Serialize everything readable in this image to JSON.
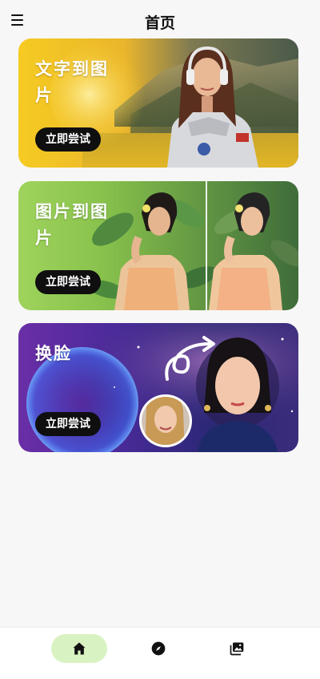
{
  "header": {
    "title": "首页",
    "menu_icon": "hamburger-menu-icon"
  },
  "cards": [
    {
      "id": "text-to-image",
      "title": "文字到图片",
      "button_label": "立即尝试",
      "gradient_colors": [
        "#f4c51d",
        "#e8b72a"
      ]
    },
    {
      "id": "image-to-image",
      "title": "图片到图片",
      "button_label": "立即尝试",
      "gradient_colors": [
        "#9bd05a",
        "#86c048"
      ]
    },
    {
      "id": "face-swap",
      "title": "换脸",
      "button_label": "立即尝试",
      "gradient_colors": [
        "#6a2fa8",
        "#3a1f8c"
      ]
    }
  ],
  "bottom_nav": {
    "items": [
      {
        "id": "home",
        "icon": "home-icon",
        "active": true
      },
      {
        "id": "explore",
        "icon": "compass-icon",
        "active": false
      },
      {
        "id": "gallery",
        "icon": "gallery-icon",
        "active": false
      }
    ],
    "active_pill_color": "#d9f2c2"
  },
  "colors": {
    "background": "#f7f7f7",
    "button_bg": "#0f0f10",
    "button_text": "#ffffff"
  }
}
